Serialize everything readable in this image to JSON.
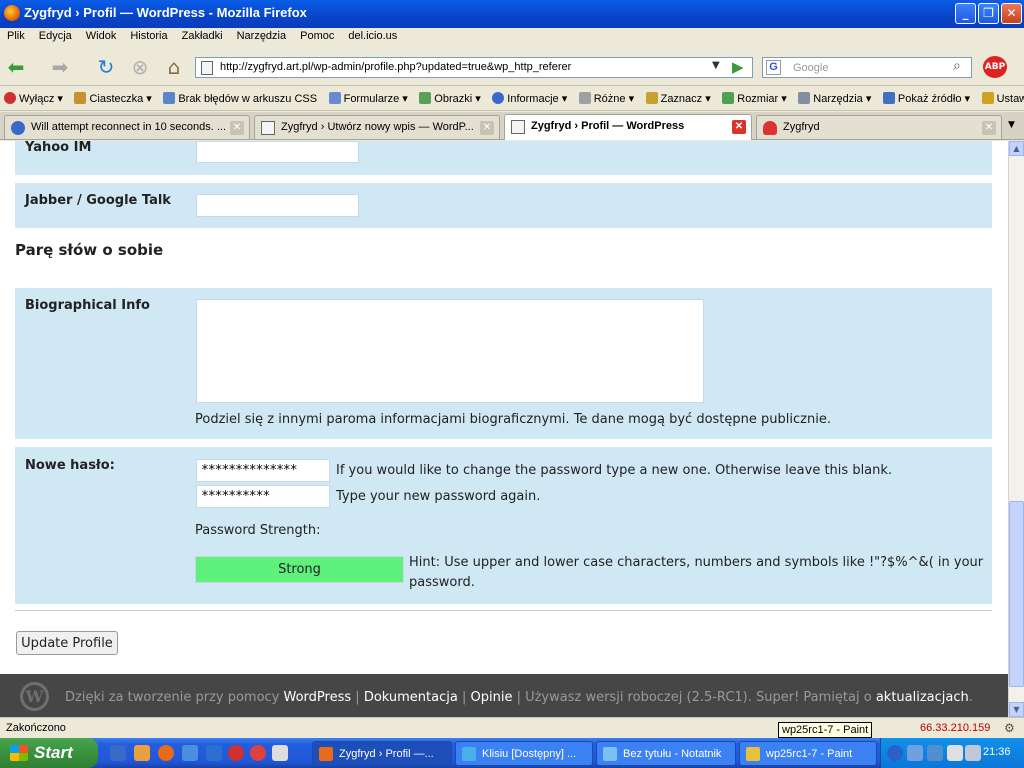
{
  "window": {
    "title": "Zygfryd › Profil — WordPress - Mozilla Firefox",
    "controls": [
      "minimize",
      "maximize",
      "close"
    ]
  },
  "menu": [
    "Plik",
    "Edycja",
    "Widok",
    "Historia",
    "Zakładki",
    "Narzędzia",
    "Pomoc",
    "del.icio.us"
  ],
  "nav": {
    "url": "http://zygfryd.art.pl/wp-admin/profile.php?updated=true&wp_http_referer",
    "search_placeholder": "Google",
    "abp_label": "ABP"
  },
  "toolbar": [
    {
      "label": "Wyłącz",
      "icon": "disable-icon",
      "color": "#d03030"
    },
    {
      "label": "Ciasteczka",
      "icon": "cookie-icon",
      "color": "#c89030"
    },
    {
      "label": "Brak błędów w arkuszu CSS",
      "icon": "css-icon",
      "color": "#5a86c8"
    },
    {
      "label": "Formularze",
      "icon": "forms-icon",
      "color": "#6a8ad0"
    },
    {
      "label": "Obrazki",
      "icon": "images-icon",
      "color": "#5aa05a"
    },
    {
      "label": "Informacje",
      "icon": "info-icon",
      "color": "#3a6ac8"
    },
    {
      "label": "Różne",
      "icon": "misc-icon",
      "color": "#a0a0a0"
    },
    {
      "label": "Zaznacz",
      "icon": "outline-icon",
      "color": "#c8a030"
    },
    {
      "label": "Rozmiar",
      "icon": "resize-icon",
      "color": "#50a050"
    },
    {
      "label": "Narzędzia",
      "icon": "tools-icon",
      "color": "#8090a0"
    },
    {
      "label": "Pokaż źródło",
      "icon": "source-icon",
      "color": "#4070c0"
    },
    {
      "label": "Ustawien",
      "icon": "options-icon",
      "color": "#d0a020"
    }
  ],
  "tabs": [
    {
      "label": "Will attempt reconnect in 10 seconds. ...",
      "active": false
    },
    {
      "label": "Zygfryd › Utwórz nowy wpis — WordP...",
      "active": false
    },
    {
      "label": "Zygfryd › Profil — WordPress",
      "active": true
    },
    {
      "label": "Zygfryd",
      "active": false
    }
  ],
  "form": {
    "yahoo_label": "Yahoo IM",
    "yahoo_value": "",
    "jabber_label": "Jabber / Google Talk",
    "jabber_value": "",
    "section_heading": "Parę słów o sobie",
    "bio_label": "Biographical Info",
    "bio_value": "",
    "bio_hint": "Podziel się z innymi paroma informacjami biograficznymi. Te dane mogą być dostępne publicznie.",
    "password_label": "Nowe hasło:",
    "password1_mask": "**************",
    "password1_hint": "If you would like to change the password type a new one. Otherwise leave this blank.",
    "password2_mask": "**********",
    "password2_hint": "Type your new password again.",
    "strength_label": "Password Strength:",
    "strength_value": "Strong",
    "strength_color": "#5ef27c",
    "strength_hint_1": "Hint: Use upper and lower case characters, numbers and symbols like !\"?$%^&( in your",
    "strength_hint_2": "password.",
    "update_button": "Update Profile"
  },
  "footer": {
    "prefix": "Dzięki za tworzenie przy pomocy ",
    "wordpress_link": "WordPress",
    "sep1": " | ",
    "docs_link": "Dokumentacja",
    "sep2": " | ",
    "feedback_link": "Opinie",
    "version_text": " | Używasz wersji roboczej (2.5-RC1). Super! Pamiętaj o ",
    "updates_link": "aktualizacjach",
    "suffix": "."
  },
  "status": {
    "text": "Zakończono",
    "tooltip": "wp25rc1-7 - Paint",
    "ip": "66.33.210.159"
  },
  "taskbar": {
    "start": "Start",
    "buttons": [
      {
        "label": "Zygfryd › Profil —...",
        "color": "#e86a1a",
        "active": true
      },
      {
        "label": "Klisiu [Dostępny] ...",
        "color": "#4ab0e8",
        "active": false
      },
      {
        "label": "Bez tytułu - Notatnik",
        "color": "#7ac0f0",
        "active": false
      },
      {
        "label": "wp25rc1-7 - Paint",
        "color": "#e8c040",
        "active": false
      }
    ],
    "clock": "21:36"
  }
}
